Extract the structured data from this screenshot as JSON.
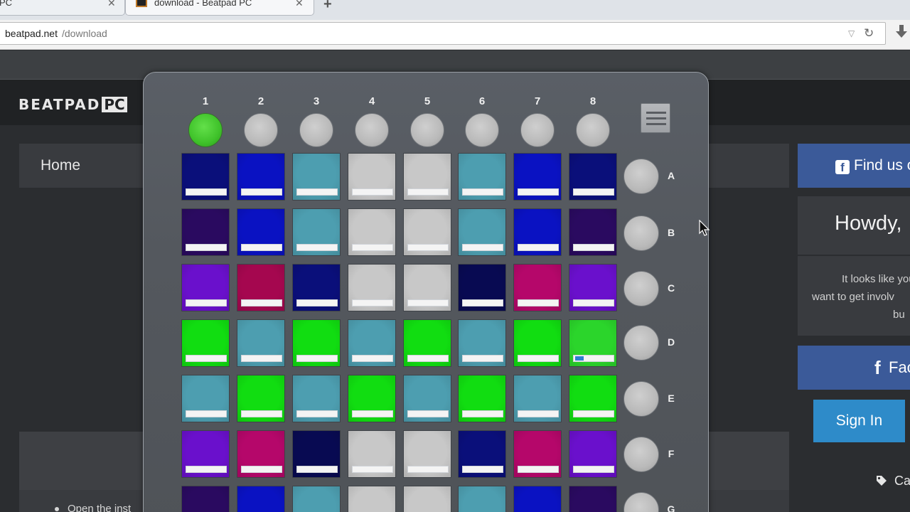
{
  "browser": {
    "tabs": [
      {
        "title": "PC",
        "active": false
      },
      {
        "title": "download - Beatpad PC",
        "active": true
      }
    ],
    "new_tab_label": "+",
    "close_glyph": "✕",
    "url_host": "beatpad.net",
    "url_path": "/download",
    "dropdown_glyph": "▽",
    "reload_glyph": "↻"
  },
  "site": {
    "logo_text": "BEATPAD",
    "logo_badge": "PC",
    "nav_home": "Home",
    "sidebar": {
      "find_us": "Find us o",
      "fb_glyph": "f",
      "howdy": "Howdy,",
      "text_lines": [
        "It looks like you'",
        "want to get involv",
        "bu"
      ],
      "facebook_button": "Fac",
      "sign_in": "Sign In",
      "tag_label": "Ca"
    },
    "content_bullet": "Open the inst"
  },
  "launchpad": {
    "columns": [
      "1",
      "2",
      "3",
      "4",
      "5",
      "6",
      "7",
      "8"
    ],
    "active_top_button": 0,
    "rows": [
      "A",
      "B",
      "C",
      "D",
      "E",
      "F",
      "G"
    ],
    "palette": {
      "N": "#0a0f7a",
      "B": "#0a12c2",
      "T": "#4d9eb0",
      "W": "#c8c8c8",
      "K": "#080a52",
      "D": "#2a0a60",
      "P": "#6a10cc",
      "M": "#a5074f",
      "R": "#b5076a",
      "G": "#11dd11",
      "L": "#2bd52b"
    },
    "grid": [
      [
        "N",
        "B",
        "T",
        "W",
        "W",
        "T",
        "B",
        "N"
      ],
      [
        "D",
        "B",
        "T",
        "W",
        "W",
        "T",
        "B",
        "D"
      ],
      [
        "P",
        "M",
        "N",
        "W",
        "W",
        "K",
        "R",
        "P"
      ],
      [
        "G",
        "T",
        "G",
        "T",
        "G",
        "T",
        "G",
        "L"
      ],
      [
        "T",
        "G",
        "T",
        "G",
        "T",
        "G",
        "T",
        "G"
      ],
      [
        "P",
        "R",
        "K",
        "W",
        "W",
        "N",
        "R",
        "P"
      ],
      [
        "D",
        "B",
        "T",
        "W",
        "W",
        "T",
        "B",
        "D"
      ]
    ],
    "marked_pad": {
      "row": 3,
      "col": 7
    }
  },
  "icons": {
    "download": "download-icon",
    "menu": "hamburger-menu-icon",
    "cursor": "mouse-cursor-icon",
    "tag": "tag-icon",
    "facebook": "facebook-icon"
  }
}
